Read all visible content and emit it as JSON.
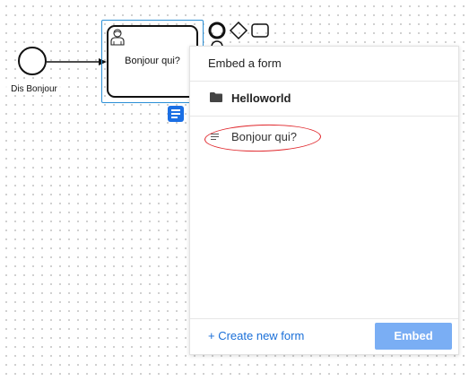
{
  "diagram": {
    "start_event_label": "Dis Bonjour",
    "task_label": "Bonjour qui?"
  },
  "popup": {
    "title": "Embed a form",
    "group_label": "Helloworld",
    "forms": [
      {
        "label": "Bonjour qui?",
        "icon": "form-lines-icon"
      }
    ],
    "create_link": "+ Create new form",
    "embed_button": "Embed"
  },
  "colors": {
    "selection": "#2a8fd6",
    "form_badge": "#1b6fe4",
    "link": "#1a6fd8",
    "embed_button": "#7aaef4",
    "highlight": "#e0262b"
  }
}
